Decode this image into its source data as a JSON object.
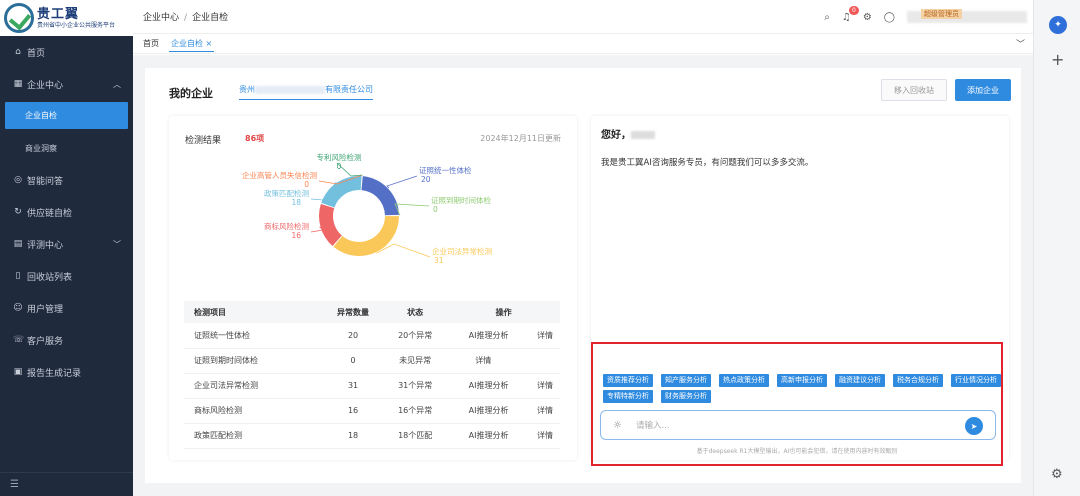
{
  "sidebar": {
    "logo_main": "贵工翼",
    "logo_sub": "贵州省中小企业公共服务平台",
    "items": [
      {
        "label": "首页",
        "icon": "home-icon"
      },
      {
        "label": "企业中心",
        "icon": "building-icon"
      },
      {
        "label": "企业自检",
        "sub": true,
        "active": true
      },
      {
        "label": "商业洞察",
        "sub": true
      },
      {
        "label": "智能问答",
        "icon": "compass-icon"
      },
      {
        "label": "供应链自检",
        "icon": "refresh-icon"
      },
      {
        "label": "评测中心",
        "icon": "document-icon"
      },
      {
        "label": "回收站列表",
        "icon": "trash-icon"
      },
      {
        "label": "用户管理",
        "icon": "user-icon"
      },
      {
        "label": "客户服务",
        "icon": "support-icon"
      },
      {
        "label": "报告生成记录",
        "icon": "report-icon"
      }
    ]
  },
  "header": {
    "crumb_1": "企业中心",
    "crumb_sep": "/",
    "crumb_2": "企业自检",
    "bell_count": "0",
    "role": "超级管理员"
  },
  "tabs": {
    "home": "首页",
    "active": "企业自检 ×"
  },
  "main": {
    "title": "我的企业",
    "company_prefix": "贵州",
    "company_suffix": "有限责任公司",
    "recycle_btn": "移入回收站",
    "add_btn": "添加企业"
  },
  "detect": {
    "title": "检测结果",
    "count": "86项",
    "date": "2024年12月11日更新"
  },
  "chart_data": {
    "type": "pie",
    "categories": [
      "证照统一性体检",
      "证照到期时间体检",
      "企业司法异常检测",
      "商标风险检测",
      "政策匹配检测",
      "企业高管人员失信检测",
      "专利风险检测"
    ],
    "values": [
      20,
      0,
      31,
      16,
      18,
      0,
      0
    ],
    "colors": [
      "#5470c6",
      "#91cc75",
      "#fac858",
      "#ee6666",
      "#73c0de",
      "#fc8452",
      "#3ba272"
    ]
  },
  "table": {
    "headers": [
      "检测项目",
      "异常数量",
      "状态",
      "操作"
    ],
    "rows": [
      {
        "name": "证照统一性体检",
        "count": "20",
        "status": "20个异常",
        "status_type": "red",
        "ai": "AI推理分析",
        "detail": "详情"
      },
      {
        "name": "证照到期时间体检",
        "count": "0",
        "status": "未见异常",
        "status_type": "green",
        "ai": "",
        "detail": "详情"
      },
      {
        "name": "企业司法异常检测",
        "count": "31",
        "status": "31个异常",
        "status_type": "red",
        "ai": "AI推理分析",
        "detail": "详情"
      },
      {
        "name": "商标风险检测",
        "count": "16",
        "status": "16个异常",
        "status_type": "red",
        "ai": "AI推理分析",
        "detail": "详情"
      },
      {
        "name": "政策匹配检测",
        "count": "18",
        "status": "18个匹配",
        "status_type": "red",
        "ai": "AI推理分析",
        "detail": "详情"
      }
    ]
  },
  "chat": {
    "greeting": "您好，",
    "intro": "我是贵工翼AI咨询服务专员，有问题我们可以多多交流。",
    "chips": [
      "资质推荐分析",
      "知产服务分析",
      "热点政策分析",
      "高新申报分析",
      "融资建议分析",
      "税务合规分析",
      "行业情况分析",
      "专精特新分析",
      "财务服务分析"
    ],
    "placeholder": "请输入...",
    "disclaimer": "基于deepseek R1大模型输出，AI也可能会犯错，请在使用内容时有效甄别"
  }
}
